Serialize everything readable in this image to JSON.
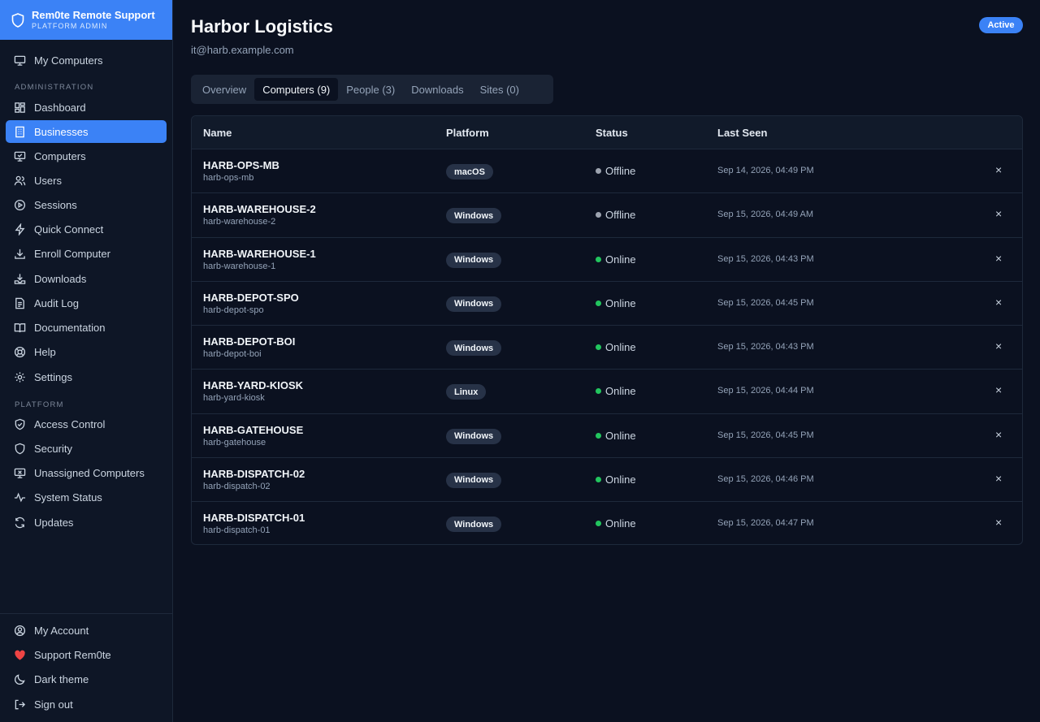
{
  "brand": {
    "title": "Rem0te Remote Support",
    "subtitle": "PLATFORM ADMIN"
  },
  "sidebar": {
    "top_item": "My Computers",
    "section_admin": "ADMINISTRATION",
    "admin_items": [
      "Dashboard",
      "Businesses",
      "Computers",
      "Users",
      "Sessions",
      "Quick Connect",
      "Enroll Computer",
      "Downloads",
      "Audit Log",
      "Documentation",
      "Help",
      "Settings"
    ],
    "active_item": "Businesses",
    "section_platform": "PLATFORM",
    "platform_items": [
      "Access Control",
      "Security",
      "Unassigned Computers",
      "System Status",
      "Updates"
    ],
    "footer_items": [
      "My Account",
      "Support Rem0te",
      "Dark theme",
      "Sign out"
    ]
  },
  "page": {
    "title": "Harbor Logistics",
    "email": "it@harb.example.com",
    "status_badge": "Active"
  },
  "tabs": [
    "Overview",
    "Computers (9)",
    "People (3)",
    "Downloads",
    "Sites (0)"
  ],
  "active_tab": "Computers (9)",
  "table": {
    "headers": {
      "name": "Name",
      "platform": "Platform",
      "status": "Status",
      "last_seen": "Last Seen"
    },
    "rows": [
      {
        "name": "HARB-OPS-MB",
        "host": "harb-ops-mb",
        "platform": "macOS",
        "status": "Offline",
        "last_seen": "Sep 14, 2026, 04:49 PM"
      },
      {
        "name": "HARB-WAREHOUSE-2",
        "host": "harb-warehouse-2",
        "platform": "Windows",
        "status": "Offline",
        "last_seen": "Sep 15, 2026, 04:49 AM"
      },
      {
        "name": "HARB-WAREHOUSE-1",
        "host": "harb-warehouse-1",
        "platform": "Windows",
        "status": "Online",
        "last_seen": "Sep 15, 2026, 04:43 PM"
      },
      {
        "name": "HARB-DEPOT-SPO",
        "host": "harb-depot-spo",
        "platform": "Windows",
        "status": "Online",
        "last_seen": "Sep 15, 2026, 04:45 PM"
      },
      {
        "name": "HARB-DEPOT-BOI",
        "host": "harb-depot-boi",
        "platform": "Windows",
        "status": "Online",
        "last_seen": "Sep 15, 2026, 04:43 PM"
      },
      {
        "name": "HARB-YARD-KIOSK",
        "host": "harb-yard-kiosk",
        "platform": "Linux",
        "status": "Online",
        "last_seen": "Sep 15, 2026, 04:44 PM"
      },
      {
        "name": "HARB-GATEHOUSE",
        "host": "harb-gatehouse",
        "platform": "Windows",
        "status": "Online",
        "last_seen": "Sep 15, 2026, 04:45 PM"
      },
      {
        "name": "HARB-DISPATCH-02",
        "host": "harb-dispatch-02",
        "platform": "Windows",
        "status": "Online",
        "last_seen": "Sep 15, 2026, 04:46 PM"
      },
      {
        "name": "HARB-DISPATCH-01",
        "host": "harb-dispatch-01",
        "platform": "Windows",
        "status": "Online",
        "last_seen": "Sep 15, 2026, 04:47 PM"
      }
    ],
    "remove_glyph": "×"
  },
  "colors": {
    "accent": "#3b82f6",
    "online": "#22c55e",
    "offline": "#9ca3af",
    "heart": "#ef4444"
  }
}
